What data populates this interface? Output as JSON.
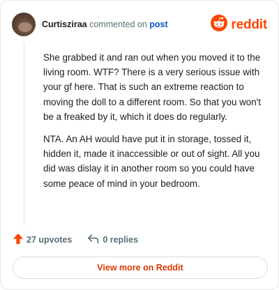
{
  "header": {
    "author": "Curtisziraa",
    "verb": "commented on",
    "post_link": "post",
    "logo_text": "reddit",
    "brand_color": "#ff4500"
  },
  "comment": {
    "paragraphs": [
      "She grabbed it and ran out when you moved it to the living room. WTF? There is a very serious issue with your gf here. That is such an extreme reaction to moving the doll to a different room. So that you won't be a freaked by it, which it does do regularly.",
      "NTA. An AH would have put it in storage, tossed it, hidden it, made it inaccessible or out of sight. All you did was dislay it in another room so you could have some peace of mind in your bedroom."
    ]
  },
  "actions": {
    "upvotes": "27 upvotes",
    "replies": "0 replies",
    "upvote_color": "#ff4500"
  },
  "footer": {
    "view_more": "View more on Reddit",
    "link_color": "#d93a00"
  },
  "icons": [
    "reddit-snoo-icon",
    "upvote-arrow-icon",
    "reply-arrow-icon"
  ]
}
